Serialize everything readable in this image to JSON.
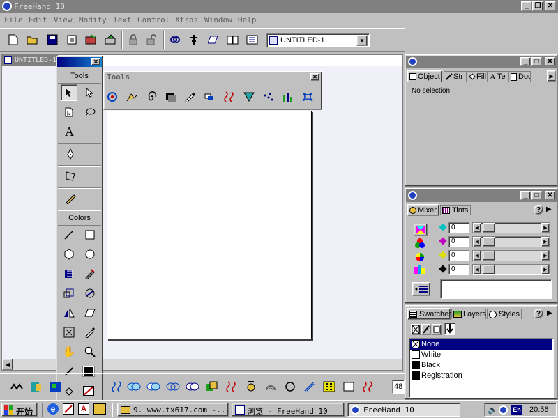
{
  "window": {
    "title": "FreeHand 10"
  },
  "menu": [
    "File",
    "Edit",
    "View",
    "Modify",
    "Text",
    "Control",
    "Xtras",
    "Window",
    "Help"
  ],
  "toolbar": {
    "document_select": "UNTITLED-1"
  },
  "document": {
    "tab_title": "UNTITLED-1"
  },
  "tools_panel": {
    "title": "Tools",
    "colors_label": "Colors"
  },
  "floating_tools": {
    "title": "Tools"
  },
  "object_panel": {
    "tabs": [
      "Object",
      "Str",
      "Fill",
      "Te",
      "Doc"
    ],
    "status": "No selection"
  },
  "mixer_panel": {
    "tabs": [
      "Mixer",
      "Tints"
    ],
    "values": [
      "0",
      "0",
      "0",
      "0"
    ]
  },
  "swatches_panel": {
    "tabs": [
      "Swatches",
      "Layers",
      "Styles"
    ],
    "items": [
      "None",
      "White",
      "Black",
      "Registration"
    ]
  },
  "statusbar": {
    "zoom": "48"
  },
  "taskbar": {
    "start": "开始",
    "tasks": [
      "9. www.tx617.com -...",
      "浏览 - FreeHand 10",
      "FreeHand 10"
    ],
    "lang": "En",
    "clock": "20:56"
  },
  "colors": {
    "titlebar_inactive": "#808080",
    "titlebar_active": "#000080",
    "selection": "#000080",
    "face": "#c0c0c0"
  }
}
